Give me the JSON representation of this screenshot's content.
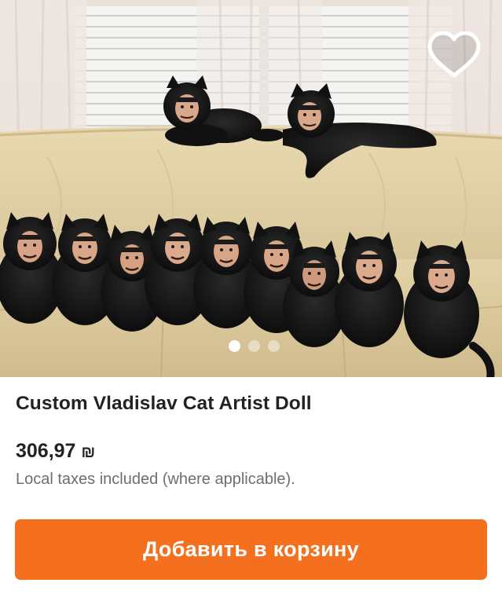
{
  "gallery": {
    "image_alt": "Black plush cat dolls with painted faces on a cream sofa",
    "favorite_icon": "heart-outline-icon",
    "slide_count": 3,
    "active_slide": 1
  },
  "product": {
    "title": "Custom Vladislav Cat Artist Doll",
    "price": "306,97",
    "currency_symbol": "₪",
    "taxes_note": "Local taxes included (where applicable)."
  },
  "actions": {
    "add_to_cart_label": "Добавить в корзину"
  },
  "colors": {
    "accent": "#f4701f",
    "text": "#222222",
    "muted_text": "#6e6e6e"
  }
}
